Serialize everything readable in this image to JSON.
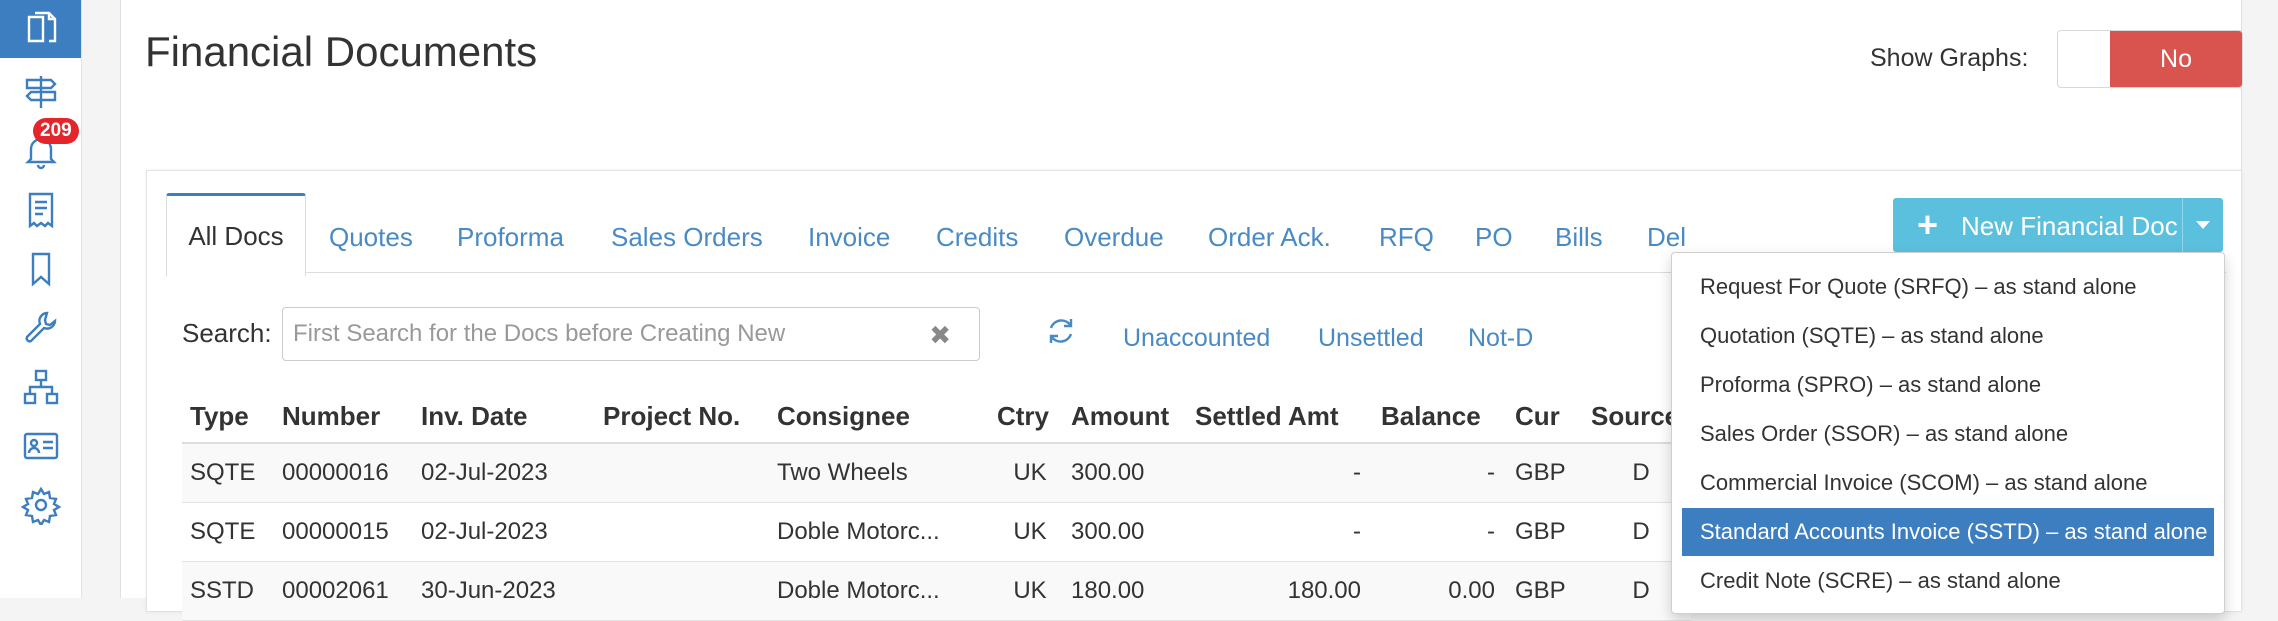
{
  "header": {
    "title": "Financial Documents",
    "show_graphs_label": "Show Graphs:",
    "show_graphs_value": "No"
  },
  "sidebar": {
    "badge_count": "209",
    "items": [
      {
        "icon": "documents-icon",
        "active": true
      },
      {
        "icon": "signpost-icon"
      },
      {
        "icon": "bell-icon"
      },
      {
        "icon": "receipt-icon"
      },
      {
        "icon": "bookmark-icon"
      },
      {
        "icon": "wrench-icon"
      },
      {
        "icon": "hierarchy-icon"
      },
      {
        "icon": "id-card-icon"
      },
      {
        "icon": "gear-icon"
      }
    ]
  },
  "tabs": [
    "All Docs",
    "Quotes",
    "Proforma",
    "Sales Orders",
    "Invoice",
    "Credits",
    "Overdue",
    "Order Ack.",
    "RFQ",
    "PO",
    "Bills",
    "Del"
  ],
  "new_button": {
    "label": "New Financial Doc"
  },
  "search": {
    "label": "Search:",
    "placeholder": "First Search for the Docs before Creating New"
  },
  "quick_filters": [
    "Unaccounted",
    "Unsettled",
    "Not-D"
  ],
  "table": {
    "columns": [
      "Type",
      "Number",
      "Inv. Date",
      "Project No.",
      "Consignee",
      "Ctry",
      "Amount",
      "Settled Amt",
      "Balance",
      "Cur",
      "Source"
    ],
    "rows": [
      [
        "SQTE",
        "00000016",
        "02-Jul-2023",
        "",
        "Two Wheels",
        "UK",
        "300.00",
        "-",
        "-",
        "GBP",
        "D"
      ],
      [
        "SQTE",
        "00000015",
        "02-Jul-2023",
        "",
        "Doble Motorc...",
        "UK",
        "300.00",
        "-",
        "-",
        "GBP",
        "D"
      ],
      [
        "SSTD",
        "00002061",
        "30-Jun-2023",
        "",
        "Doble Motorc...",
        "UK",
        "180.00",
        "180.00",
        "0.00",
        "GBP",
        "D"
      ]
    ]
  },
  "dropdown": {
    "items": [
      "Request For Quote (SRFQ) – as stand alone",
      "Quotation (SQTE) – as stand alone",
      "Proforma (SPRO) – as stand alone",
      "Sales Order (SSOR) – as stand alone",
      "Commercial Invoice (SCOM) – as stand alone",
      "Standard Accounts Invoice (SSTD) – as stand alone",
      "Credit Note (SCRE) – as stand alone"
    ],
    "selected_index": 5
  },
  "colors": {
    "primary": "#3c7ec0",
    "link": "#4a8ac4",
    "info_button": "#5bc0de",
    "danger": "#d9534f",
    "badge": "#e3262c"
  }
}
